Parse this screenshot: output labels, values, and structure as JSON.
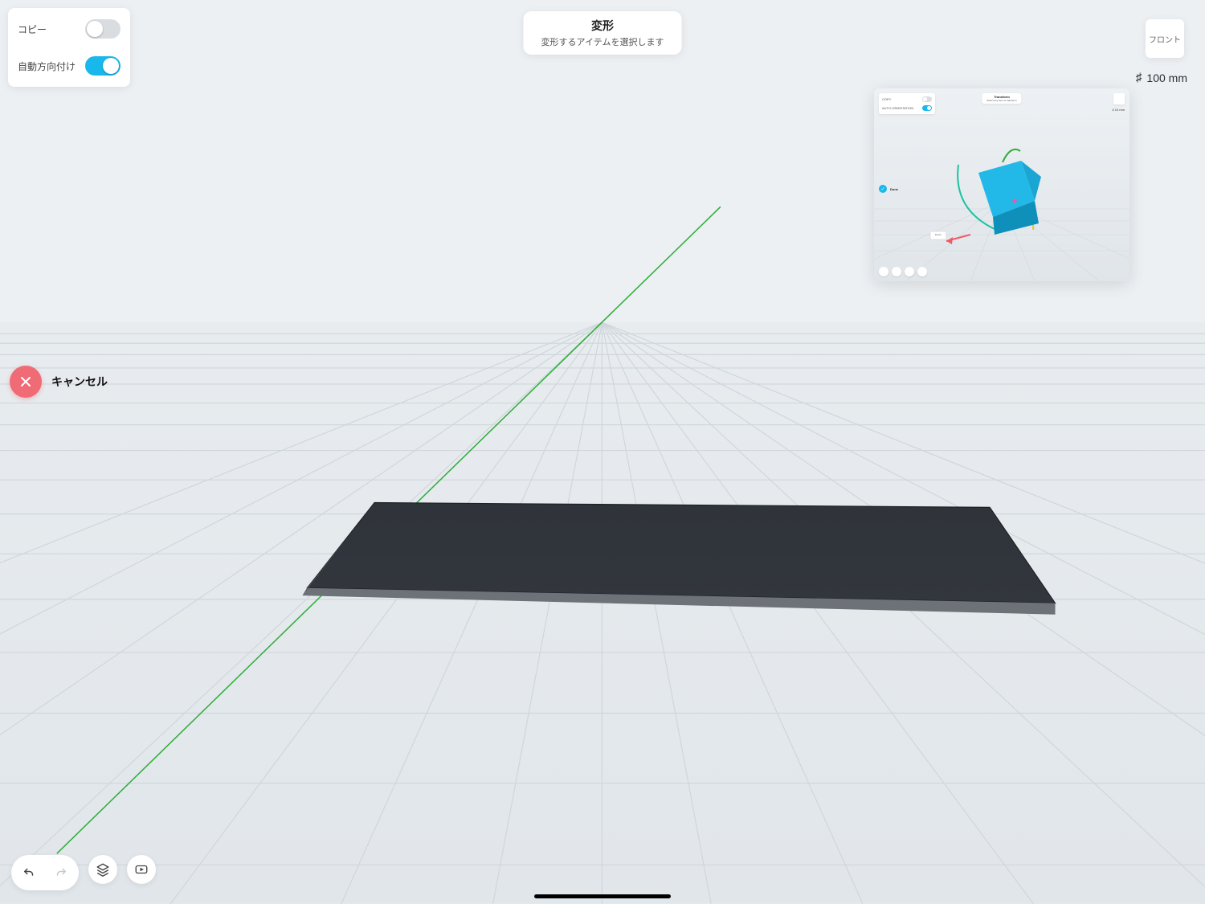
{
  "options": {
    "copy_label": "コピー",
    "copy_on": false,
    "auto_orient_label": "自動方向付け",
    "auto_orient_on": true
  },
  "mode": {
    "title": "変形",
    "subtitle": "変形するアイテムを選択します"
  },
  "view_button_label": "フロント",
  "grid_readout": "100 mm",
  "cancel_label": "キャンセル",
  "thumbnail": {
    "copy_label": "COPY",
    "auto_orient_label": "AUTO-ORIENTATION",
    "banner_title": "Transform",
    "banner_sub": "Select any item to transform",
    "grid_readout": "10 mm",
    "done_label": "Done",
    "translate_tag": "0 mm"
  },
  "icons": {
    "undo": "undo-icon",
    "redo": "redo-icon",
    "layers": "layers-icon",
    "help": "help-video-icon",
    "close": "close-icon",
    "grid_hash": "grid-hash-icon"
  }
}
